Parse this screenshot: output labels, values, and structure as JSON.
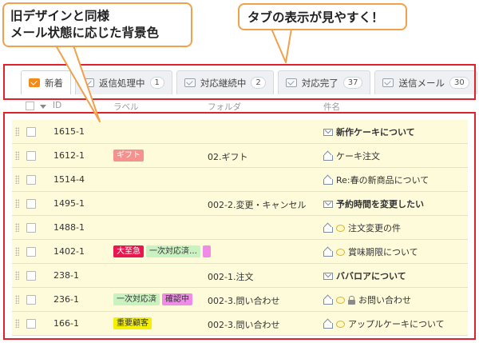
{
  "callouts": {
    "left": [
      "旧デザインと同様",
      "メール状態に応じた背景色"
    ],
    "right": "タブの表示が見やすく！"
  },
  "tabs": [
    {
      "label": "新着",
      "count": null,
      "icon": "inbox-icon",
      "active": true
    },
    {
      "label": "返信処理中",
      "count": "1",
      "icon": "mailbox-icon",
      "active": false
    },
    {
      "label": "対応継続中",
      "count": "2",
      "icon": "mailbox-icon",
      "active": false
    },
    {
      "label": "対応完了",
      "count": "37",
      "icon": "mailbox-icon",
      "active": false
    },
    {
      "label": "送信メール",
      "count": "30",
      "icon": "mailbox-icon",
      "active": false
    }
  ],
  "columns": {
    "id": "ID",
    "label": "ラベル",
    "folder": "フォルダ",
    "subject": "件名"
  },
  "rows": [
    {
      "id": "1615-1",
      "labels": [],
      "folder": "",
      "icons": [
        "envelope-closed-icon"
      ],
      "subject": "新作ケーキについて",
      "bold": true
    },
    {
      "id": "1612-1",
      "labels": [
        {
          "text": "ギフト",
          "bg": "#f5918f",
          "fg": "#ffffff"
        }
      ],
      "folder": "02.ギフト",
      "icons": [
        "envelope-open-icon"
      ],
      "subject": "ケーキ注文",
      "bold": false
    },
    {
      "id": "1514-4",
      "labels": [],
      "folder": "",
      "icons": [
        "envelope-open-icon"
      ],
      "subject": "Re:春の新商品について",
      "bold": false
    },
    {
      "id": "1495-1",
      "labels": [],
      "folder": "002-2.変更・キャンセル",
      "icons": [
        "envelope-closed-icon"
      ],
      "subject": "予約時間を変更したい",
      "bold": true
    },
    {
      "id": "1488-1",
      "labels": [],
      "folder": "",
      "icons": [
        "envelope-open-icon",
        "comment-icon"
      ],
      "subject": "注文変更の件",
      "bold": false
    },
    {
      "id": "1402-1",
      "labels": [
        {
          "text": "大至急",
          "bg": "#e8174f",
          "fg": "#ffffff"
        },
        {
          "text": "一次対応済…",
          "bg": "#c9f2c0",
          "fg": "#333333"
        },
        {
          "text": "",
          "bg": "#f08ce8",
          "fg": "#333333"
        }
      ],
      "folder": "",
      "icons": [
        "envelope-open-icon",
        "comment-icon"
      ],
      "subject": "賞味期限について",
      "bold": false
    },
    {
      "id": "238-1",
      "labels": [],
      "folder": "002-1.注文",
      "icons": [
        "envelope-closed-icon"
      ],
      "subject": "ババロアについて",
      "bold": true
    },
    {
      "id": "236-1",
      "labels": [
        {
          "text": "一次対応済",
          "bg": "#c9f2c0",
          "fg": "#333333"
        },
        {
          "text": "確認中",
          "bg": "#f08ce8",
          "fg": "#333333"
        }
      ],
      "folder": "002-3.問い合わせ",
      "icons": [
        "envelope-open-icon",
        "comment-icon",
        "lock-icon"
      ],
      "subject": "お問い合わせ",
      "bold": false
    },
    {
      "id": "166-1",
      "labels": [
        {
          "text": "重要顧客",
          "bg": "#f4f000",
          "fg": "#333333"
        }
      ],
      "folder": "002-3.問い合わせ",
      "icons": [
        "envelope-open-icon",
        "comment-icon"
      ],
      "subject": "アップルケーキについて",
      "bold": false
    }
  ],
  "colors": {
    "highlight": "#e0202a",
    "callout_border": "#f0a14a",
    "row_bg": "#fdfbd9"
  }
}
